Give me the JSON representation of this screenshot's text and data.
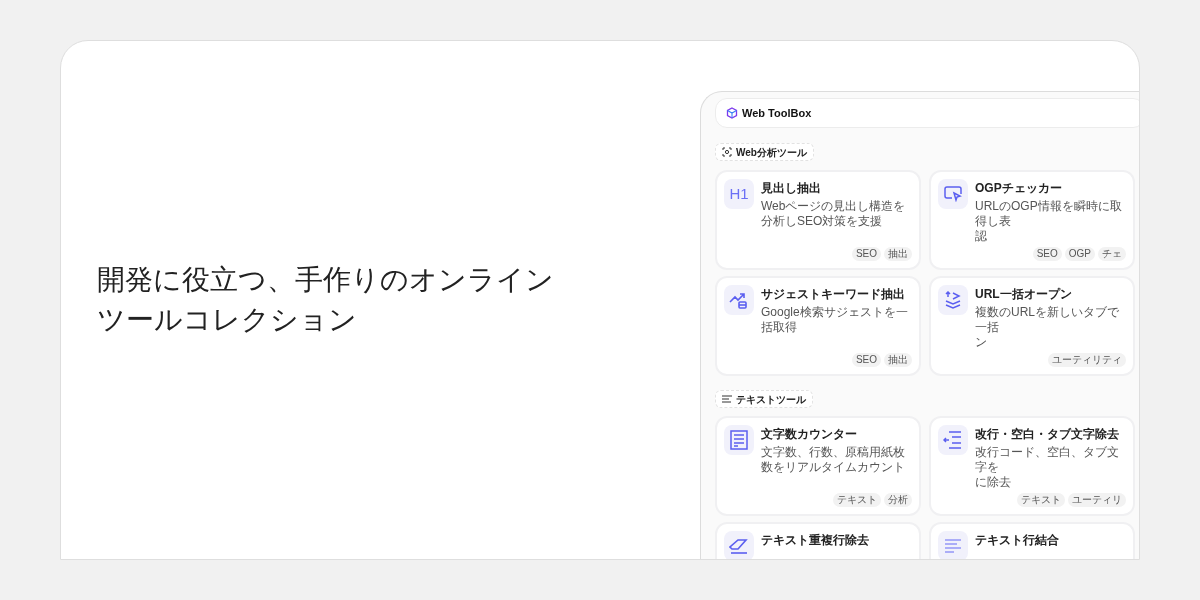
{
  "headline": "開発に役立つ、手作りのオンラインツールコレクション",
  "app": {
    "brand": "Web ToolBox",
    "sections": [
      {
        "kind": "analysis",
        "label": "Web分析ツール",
        "cards": [
          {
            "icon_text": "H1",
            "title": "見出し抽出",
            "lines": [
              "Webページの見出し構造を分析しSEO対策を支援"
            ],
            "tags": [
              "SEO",
              "抽出"
            ]
          },
          {
            "title": "OGPチェッカー",
            "lines": [
              "URLのOGP情報を瞬時に取得し表",
              "認"
            ],
            "tags": [
              "SEO",
              "OGP",
              "チェ"
            ]
          },
          {
            "title": "サジェストキーワード抽出",
            "lines": [
              "Google検索サジェストを一括取得"
            ],
            "tags": [
              "SEO",
              "抽出"
            ]
          },
          {
            "title": "URL一括オープン",
            "lines": [
              "複数のURLを新しいタブで一括",
              "ン"
            ],
            "tags": [
              "ユーティリティ"
            ]
          }
        ]
      },
      {
        "kind": "text",
        "label": "テキストツール",
        "cards": [
          {
            "title": "文字数カウンター",
            "lines": [
              "文字数、行数、原稿用紙枚数をリアルタイムカウント"
            ],
            "tags": [
              "テキスト",
              "分析"
            ]
          },
          {
            "title": "改行・空白・タブ文字除去",
            "lines": [
              "改行コード、空白、タブ文字を",
              "に除去"
            ],
            "tags": [
              "テキスト",
              "ユーティリ"
            ]
          },
          {
            "title": "テキスト重複行除去"
          },
          {
            "title": "テキスト行結合"
          }
        ]
      }
    ]
  }
}
